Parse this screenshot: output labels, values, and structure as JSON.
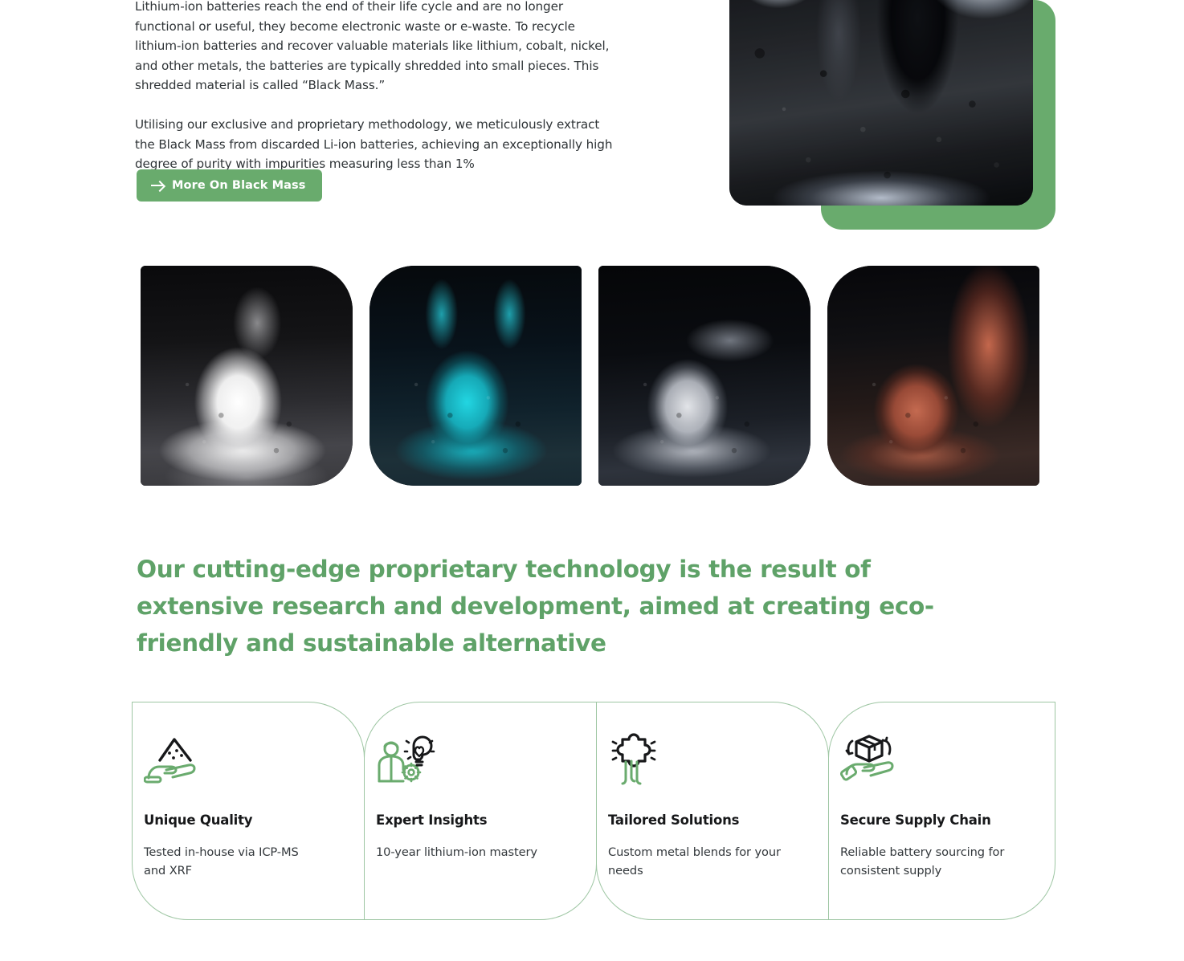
{
  "intro": {
    "paragraph_1": "Lithium-ion batteries reach the end of their life cycle and are no longer functional or useful, they become electronic waste or e-waste. To recycle lithium-ion batteries and recover valuable materials like lithium, cobalt, nickel, and other metals, the batteries are typically shredded into small pieces. This shredded material is called “Black Mass.”",
    "paragraph_2": "Utilising our exclusive and proprietary methodology, we meticulously extract the Black Mass from discarded Li-ion batteries, achieving an exceptionally high degree of purity with impurities measuring less than 1%",
    "cta_label": "More On Black Mass",
    "cta_icon": "arrow-right-icon"
  },
  "hero": {
    "image_alt": "black-mass-powder-photo",
    "accent_color": "#69ab6d"
  },
  "powder_gallery": [
    {
      "name": "white-powder-image",
      "alt": "white lithium powder pile"
    },
    {
      "name": "cyan-powder-image",
      "alt": "cyan cobalt powder pile"
    },
    {
      "name": "grey-powder-image",
      "alt": "grey nickel powder pile"
    },
    {
      "name": "red-powder-image",
      "alt": "red copper powder pile"
    }
  ],
  "headline": {
    "text": "Our cutting-edge proprietary technology is the result of extensive research and development, aimed at creating eco-friendly and sustainable alternative",
    "color": "#5fa268"
  },
  "features": {
    "border_color": "#9ec6a3",
    "items": [
      {
        "icon": "hand-holding-powder-icon",
        "title": "Unique Quality",
        "description": "Tested in-house via ICP-MS and XRF"
      },
      {
        "icon": "expert-lightbulb-gear-icon",
        "title": "Expert Insights",
        "description": "10-year lithium-ion mastery"
      },
      {
        "icon": "hand-holding-puzzle-icon",
        "title": "Tailored Solutions",
        "description": "Custom metal blends for your needs"
      },
      {
        "icon": "hand-holding-box-icon",
        "title": "Secure Supply Chain",
        "description": "Reliable battery sourcing for consistent supply"
      }
    ]
  }
}
